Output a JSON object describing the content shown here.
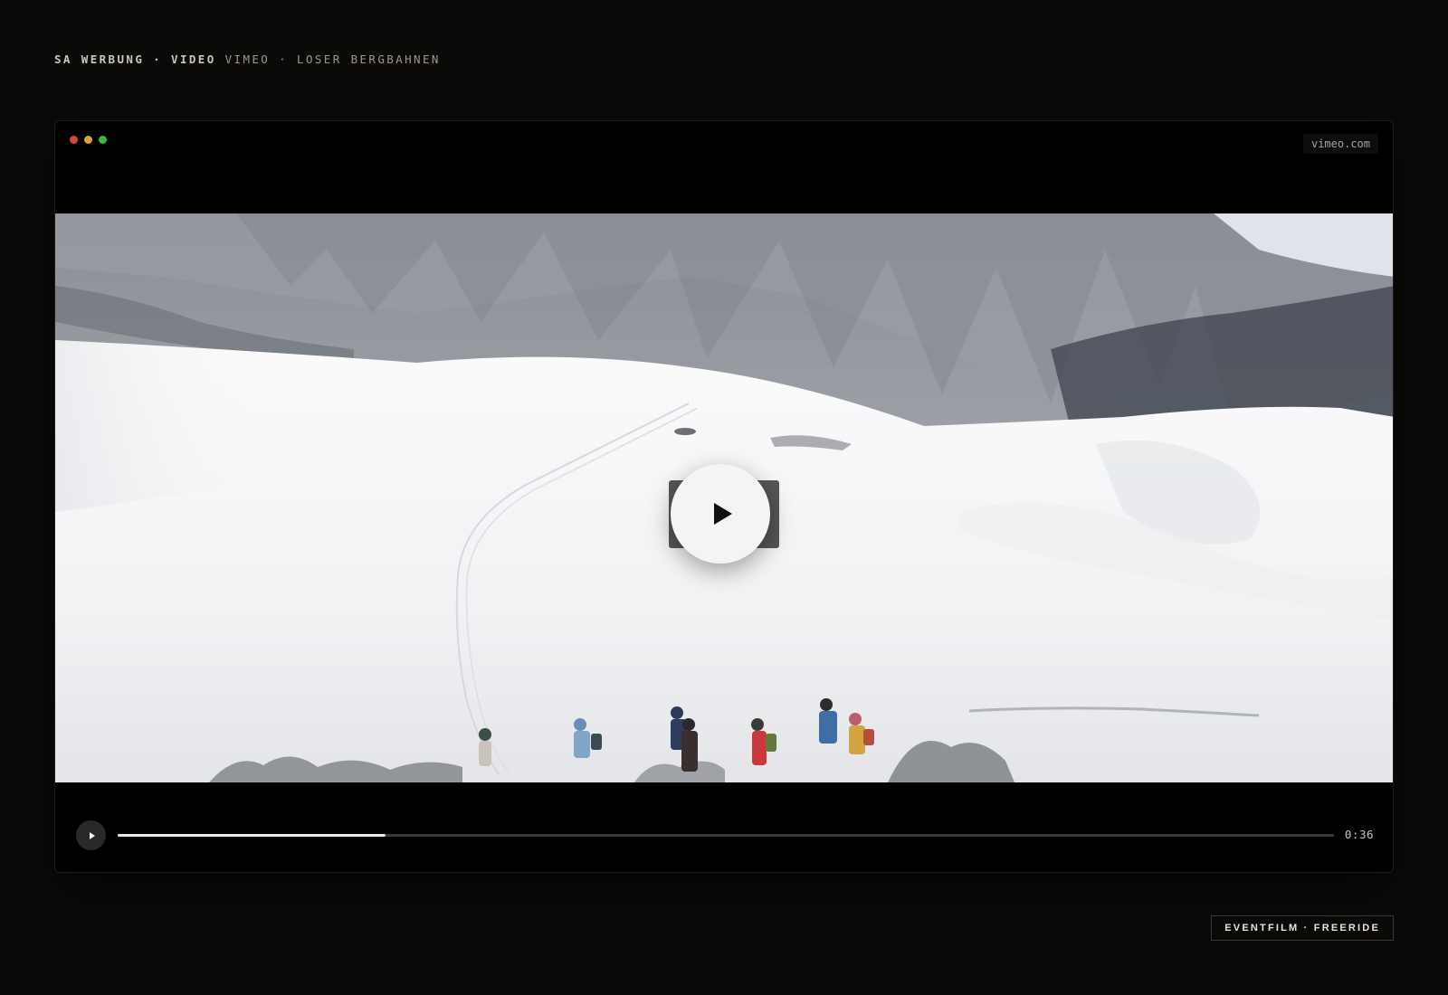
{
  "header": {
    "breadcrumb_strong": "SA WERBUNG · VIDEO",
    "breadcrumb_light": "VIMEO · LOSER BERGBAHNEN"
  },
  "window": {
    "traffic_lights": [
      "#d9453e",
      "#d9a23a",
      "#3fb449"
    ],
    "host_label": "vimeo.com"
  },
  "video": {
    "thumbnail_description_icon": "snowy-mountain-scene",
    "play_icon": "play-icon",
    "progress": 0.22,
    "time_remaining": "0:36"
  },
  "footer": {
    "tag": "EVENTFILM · FREERIDE"
  },
  "colors": {
    "background": "#0b0a09",
    "player": "#000000",
    "progress_fill": "#eae7e2",
    "progress_track": "#3a3937"
  }
}
